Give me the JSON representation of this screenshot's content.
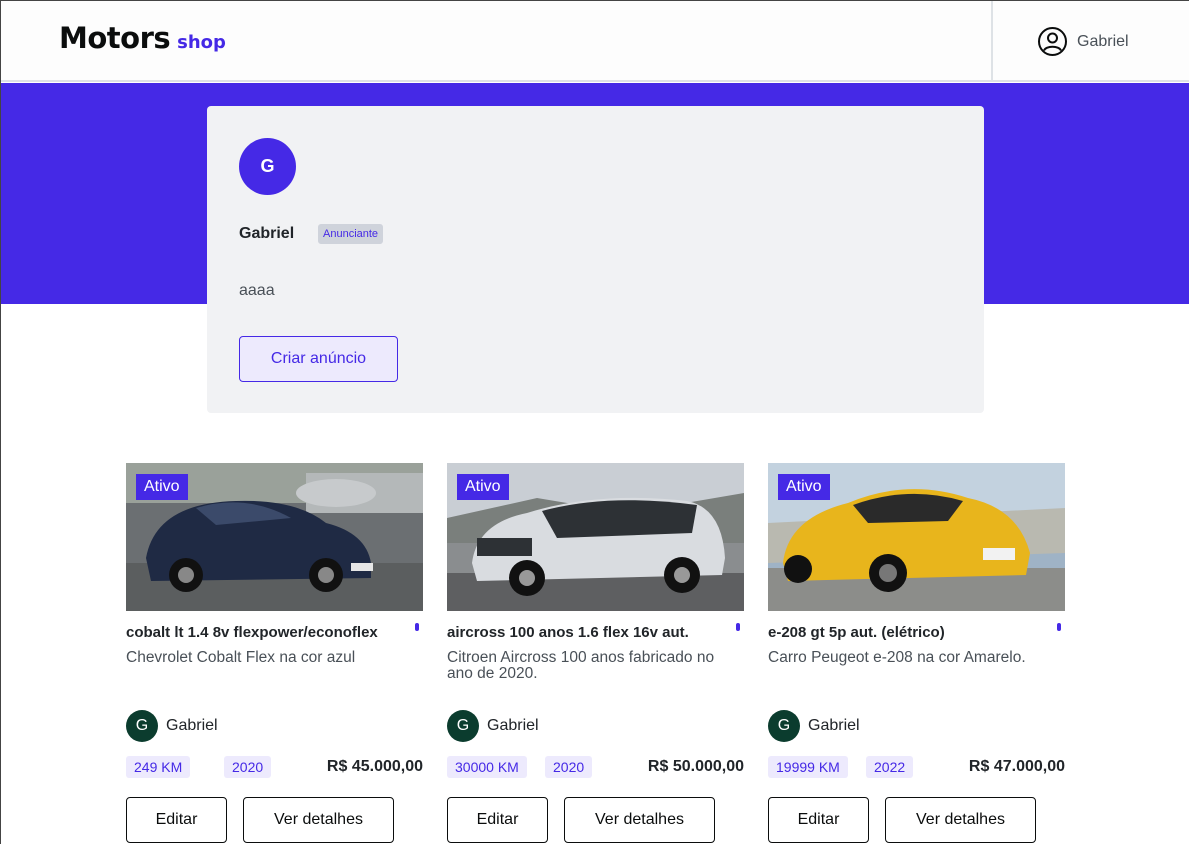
{
  "header": {
    "logo_main": "Motors",
    "logo_sub": "shop",
    "user_name": "Gabriel"
  },
  "profile": {
    "initial": "G",
    "name": "Gabriel",
    "badge": "Anunciante",
    "description": "aaaa",
    "create_button": "Criar anúncio"
  },
  "cards": [
    {
      "status": "Ativo",
      "title": "cobalt lt 1.4 8v flexpower/econoflex",
      "description": "Chevrolet Cobalt Flex na cor azul",
      "seller_initial": "G",
      "seller_name": "Gabriel",
      "km": "249 KM",
      "year": "2020",
      "price": "R$ 45.000,00",
      "edit_label": "Editar",
      "details_label": "Ver detalhes",
      "car_color": "#1f2a44"
    },
    {
      "status": "Ativo",
      "title": "aircross 100 anos 1.6 flex 16v aut.",
      "description": "Citroen Aircross 100 anos fabricado no ano de 2020.",
      "seller_initial": "G",
      "seller_name": "Gabriel",
      "km": "30000 KM",
      "year": "2020",
      "price": "R$ 50.000,00",
      "edit_label": "Editar",
      "details_label": "Ver detalhes",
      "car_color": "#d9dce0"
    },
    {
      "status": "Ativo",
      "title": "e-208 gt 5p aut. (elétrico)",
      "description": "Carro Peugeot e-208 na cor Amarelo.",
      "seller_initial": "G",
      "seller_name": "Gabriel",
      "km": "19999 KM",
      "year": "2022",
      "price": "R$ 47.000,00",
      "edit_label": "Editar",
      "details_label": "Ver detalhes",
      "car_color": "#e8b51c"
    }
  ],
  "colors": {
    "brand": "#4529e6",
    "brand_light": "#edeafd",
    "seller_avatar": "#0b3c2e"
  }
}
